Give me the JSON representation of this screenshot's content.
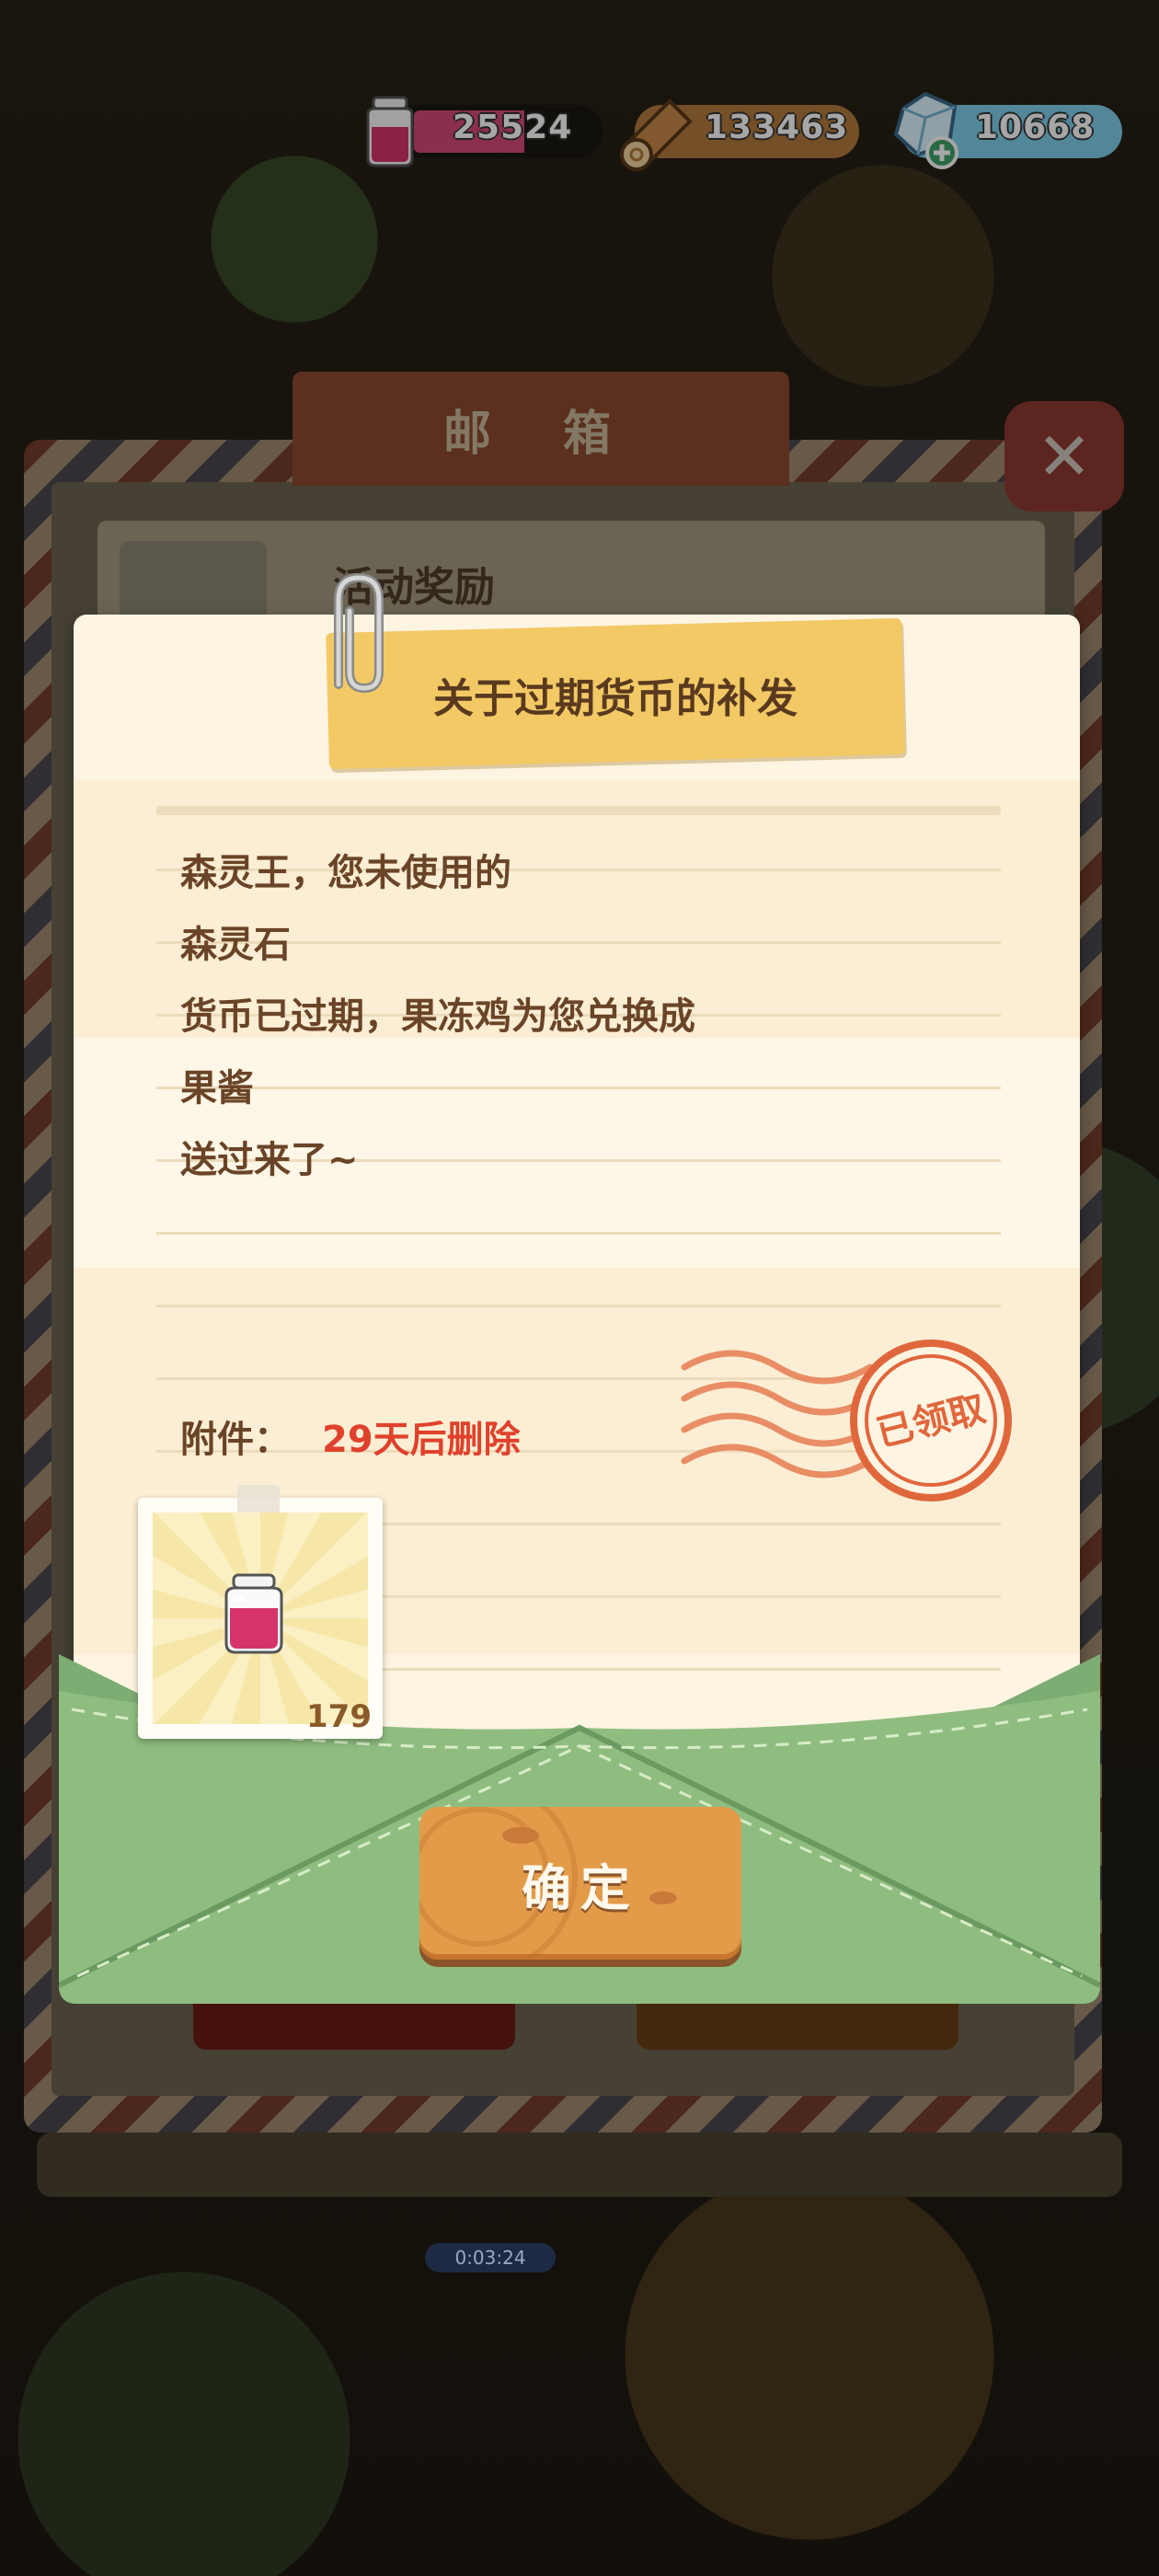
{
  "currencies": {
    "jam": {
      "amount": "25524",
      "icon": "jam-jar-icon",
      "color": "#d44b79"
    },
    "wood": {
      "amount": "133463",
      "icon": "wood-log-icon",
      "color": "#b47a3d"
    },
    "gem": {
      "amount": "10668",
      "icon": "diamond-plus-icon",
      "color": "#7fd0ec"
    }
  },
  "mailbox": {
    "title": "邮 箱",
    "close_label": "✕",
    "row_title": "活动奖励",
    "timer": "0:03:24"
  },
  "letter": {
    "title": "关于过期货币的补发",
    "lines": [
      "森灵王，您未使用的",
      "森灵石",
      "货币已过期，果冻鸡为您兑换成",
      "果酱",
      "送过来了~"
    ],
    "attachment_label": "附件：",
    "attachment_expiry": "29天后删除",
    "stamp_text": "已领取",
    "reward": {
      "icon": "jam-jar-icon",
      "count": "179"
    },
    "confirm_label": "确定"
  }
}
